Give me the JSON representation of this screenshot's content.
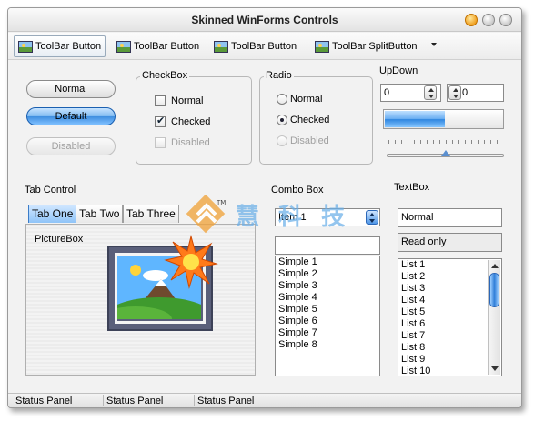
{
  "window": {
    "title": "Skinned WinForms Controls"
  },
  "toolbar": {
    "items": [
      {
        "label": "ToolBar Button"
      },
      {
        "label": "ToolBar Button"
      },
      {
        "label": "ToolBar Button"
      },
      {
        "label": "ToolBar SplitButton"
      }
    ]
  },
  "buttons": {
    "normal": "Normal",
    "default": "Default",
    "disabled": "Disabled"
  },
  "checkbox": {
    "title": "CheckBox",
    "items": [
      {
        "label": "Normal",
        "checked": false
      },
      {
        "label": "Checked",
        "checked": true
      },
      {
        "label": "Disabled",
        "checked": false
      }
    ]
  },
  "radio": {
    "title": "Radio",
    "items": [
      {
        "label": "Normal",
        "checked": false
      },
      {
        "label": "Checked",
        "checked": true
      },
      {
        "label": "Disabled",
        "checked": false
      }
    ]
  },
  "updown": {
    "title": "UpDown",
    "value1": "0",
    "value2": "0",
    "progress": 0.5,
    "slider": 0.5
  },
  "tabcontrol": {
    "title": "Tab Control",
    "tabs": [
      "Tab One",
      "Tab Two",
      "Tab Three"
    ],
    "picturebox_label": "PictureBox"
  },
  "combo": {
    "title": "Combo Box",
    "selected": "Item 1",
    "list": [
      "Simple 1",
      "Simple 2",
      "Simple 3",
      "Simple 4",
      "Simple 5",
      "Simple 6",
      "Simple 7",
      "Simple 8"
    ]
  },
  "textbox": {
    "title": "TextBox",
    "normal": "Normal",
    "readonly": "Read only",
    "list": [
      "List 1",
      "List 2",
      "List 3",
      "List 4",
      "List 5",
      "List 6",
      "List 7",
      "List 8",
      "List 9",
      "List 10"
    ]
  },
  "status": {
    "panels": [
      "Status Panel",
      "Status Panel",
      "Status Panel"
    ]
  },
  "watermark": {
    "text": "慧 科 技"
  },
  "colors": {
    "accent": "#3b8de0",
    "window_bg": "#f2f2f2"
  }
}
